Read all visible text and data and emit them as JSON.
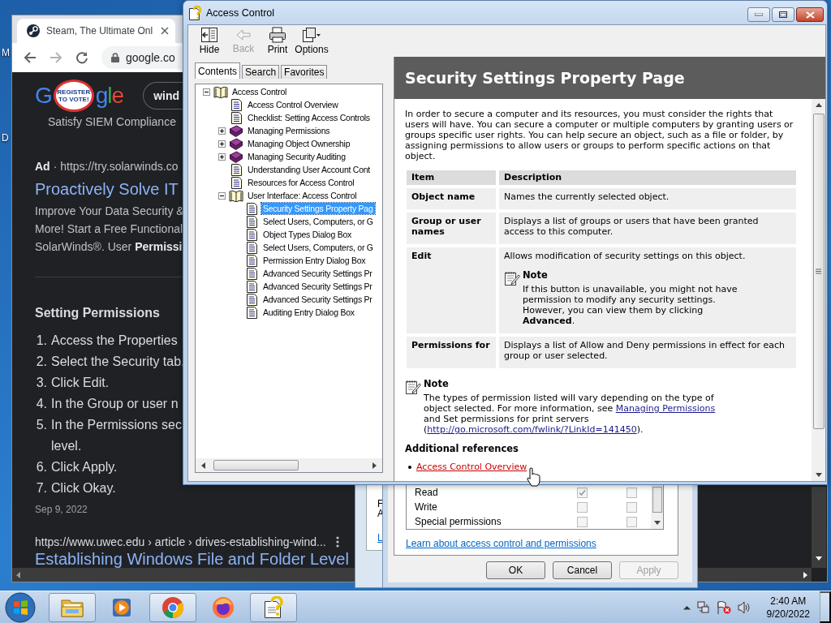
{
  "desktop": {
    "icon_labels": [
      "M",
      "D"
    ]
  },
  "browser": {
    "tab": {
      "title": "Steam, The Ultimate Onl"
    },
    "address": "google.co",
    "logo": {
      "parts": [
        "G",
        "gle"
      ],
      "badge_text": "REGISTER TO VOTE!"
    },
    "search_query": "wind",
    "sitelink": "Satisfy SIEM Compliance",
    "ad": {
      "label": "Ad",
      "url": "· https://try.solarwinds.co",
      "title": "Proactively Solve IT",
      "description_lines": [
        "Improve Your Data Security &",
        "More! Start a Free Functional",
        "SolarWinds®. User **Permissi**"
      ]
    },
    "snippet": {
      "heading": "Setting Permissions",
      "steps": [
        {
          "number": "1.",
          "lines": [
            "Access the Properties"
          ]
        },
        {
          "number": "2.",
          "lines": [
            "Select the Security tab."
          ]
        },
        {
          "number": "3.",
          "lines": [
            "Click Edit."
          ]
        },
        {
          "number": "4.",
          "lines": [
            "In the Group or user n"
          ]
        },
        {
          "number": "5.",
          "lines": [
            "In the Permissions sec",
            "level."
          ]
        },
        {
          "number": "6.",
          "lines": [
            "Click Apply."
          ]
        },
        {
          "number": "7.",
          "lines": [
            "Click Okay."
          ]
        }
      ],
      "date": "Sep 9, 2022"
    },
    "result": {
      "cite": "https://www.uwec.edu › article › drives-establishing-wind...",
      "title": "Establishing Windows File and Folder Level"
    }
  },
  "properties_window": {
    "texts": [
      "F",
      "A"
    ],
    "link": "L"
  },
  "permissions_dialog": {
    "permissions": [
      {
        "name": "Read",
        "allow_checked": true,
        "deny_checked": false
      },
      {
        "name": "Write",
        "allow_checked": false,
        "deny_checked": false
      },
      {
        "name": "Special permissions",
        "allow_checked": false,
        "deny_checked": false
      }
    ],
    "link": "Learn about access control and permissions",
    "buttons": [
      {
        "label": "OK",
        "disabled": false
      },
      {
        "label": "Cancel",
        "disabled": false
      },
      {
        "label": "Apply",
        "disabled": true
      }
    ]
  },
  "help_window": {
    "title": "Access Control",
    "toolbar": [
      {
        "kind": "hide",
        "label": "Hide",
        "disabled": false
      },
      {
        "kind": "back",
        "label": "Back",
        "disabled": true
      },
      {
        "kind": "print",
        "label": "Print",
        "disabled": false
      },
      {
        "kind": "options",
        "label": "Options",
        "disabled": false
      }
    ],
    "nav_tabs": [
      {
        "label": "Contents",
        "selected": true
      },
      {
        "label": "Search",
        "selected": false
      },
      {
        "label": "Favorites",
        "selected": false
      }
    ],
    "tree": [
      {
        "kind": "book",
        "label": "Access Control",
        "expanded": true,
        "selected": false,
        "children": [
          {
            "kind": "page",
            "label": "Access Control Overview",
            "selected": false
          },
          {
            "kind": "page",
            "label": "Checklist: Setting Access Controls",
            "selected": false
          },
          {
            "kind": "book",
            "label": "Managing Permissions",
            "expanded": false,
            "selected": false
          },
          {
            "kind": "book",
            "label": "Managing Object Ownership",
            "expanded": false,
            "selected": false
          },
          {
            "kind": "book",
            "label": "Managing Security Auditing",
            "expanded": false,
            "selected": false
          },
          {
            "kind": "page",
            "label": "Understanding User Account Cont",
            "selected": false
          },
          {
            "kind": "page",
            "label": "Resources for Access Control",
            "selected": false
          },
          {
            "kind": "book",
            "label": "User Interface: Access Control",
            "expanded": true,
            "selected": false,
            "children": [
              {
                "kind": "page",
                "label": "Security Settings Property Pag",
                "selected": true
              },
              {
                "kind": "page",
                "label": "Select Users, Computers, or G",
                "selected": false
              },
              {
                "kind": "page",
                "label": "Object Types Dialog Box",
                "selected": false
              },
              {
                "kind": "page",
                "label": "Select Users, Computers, or G",
                "selected": false
              },
              {
                "kind": "page",
                "label": "Permission Entry Dialog Box",
                "selected": false
              },
              {
                "kind": "page",
                "label": "Advanced Security Settings Pr",
                "selected": false
              },
              {
                "kind": "page",
                "label": "Advanced Security Settings Pr",
                "selected": false
              },
              {
                "kind": "page",
                "label": "Advanced Security Settings Pr",
                "selected": false
              },
              {
                "kind": "page",
                "label": "Auditing Entry Dialog Box",
                "selected": false
              }
            ]
          }
        ]
      }
    ],
    "page": {
      "title": "Security Settings Property Page",
      "intro": "In order to secure a computer and its resources, you must consider the rights that users will have. You can secure a computer or multiple computers by granting users or groups specific user rights. You can help secure an object, such as a file or folder, by assigning permissions to allow users or groups to perform specific actions on that object.",
      "table": {
        "columns": [
          "Item",
          "Description"
        ],
        "rows": [
          {
            "item": "Object name",
            "description": "Names the currently selected object."
          },
          {
            "item": "Group or user names",
            "description": "Displays a list of groups or users that have been granted access to this computer."
          },
          {
            "item": "Edit",
            "description": "Allows modification of security settings on this object.",
            "note": {
              "title": "Note",
              "text": "If this button is unavailable, you might not have permission to modify any security settings. However, you can view them by clicking **Advanced**."
            }
          },
          {
            "item": "Permissions for",
            "description": "Displays a list of Allow and Deny permissions in effect for each group or user selected."
          }
        ]
      },
      "note": {
        "title": "Note",
        "segments": [
          {
            "kind": "text",
            "text": "The types of permission listed will vary depending on the type of object selected. For more information, see "
          },
          {
            "kind": "link",
            "text": "Managing Permissions"
          },
          {
            "kind": "text",
            "text": " and Set permissions for print servers ("
          },
          {
            "kind": "link",
            "text": "http://go.microsoft.com/fwlink/?LinkId=141450"
          },
          {
            "kind": "text",
            "text": ")."
          }
        ]
      },
      "references": {
        "heading": "Additional references",
        "links": [
          {
            "text": "Access Control Overview",
            "hovered": true
          }
        ]
      }
    }
  },
  "taskbar": {
    "items": [
      {
        "kind": "folder",
        "running": true
      },
      {
        "kind": "media",
        "running": false
      },
      {
        "kind": "chrome",
        "running": true
      },
      {
        "kind": "firefox",
        "running": false
      },
      {
        "kind": "help",
        "running": true
      }
    ],
    "clock": {
      "time": "2:40 AM",
      "date": "9/20/2022"
    }
  }
}
